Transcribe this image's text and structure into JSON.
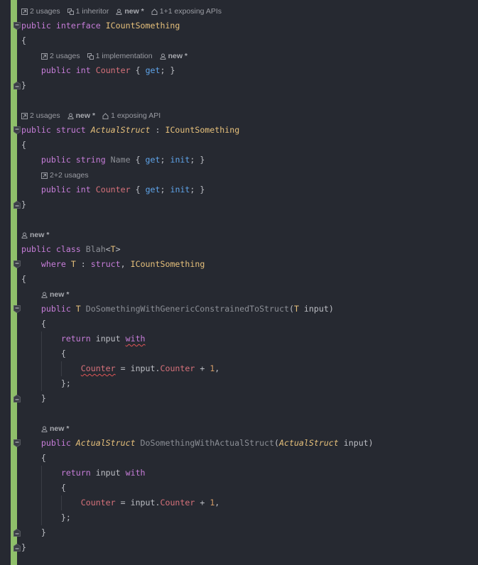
{
  "hints": {
    "interface": [
      {
        "icon": "usages-icon",
        "text": "2 usages"
      },
      {
        "icon": "inheritor-icon",
        "text": "1 inheritor"
      },
      {
        "icon": "author-icon",
        "text": "new *",
        "bold": true
      },
      {
        "icon": "api-icon",
        "text": "1+1 exposing APIs"
      }
    ],
    "interface_counter": [
      {
        "icon": "usages-icon",
        "text": "2 usages"
      },
      {
        "icon": "implementation-icon",
        "text": "1 implementation"
      },
      {
        "icon": "author-icon",
        "text": "new *",
        "bold": true
      }
    ],
    "struct": [
      {
        "icon": "usages-icon",
        "text": "2 usages"
      },
      {
        "icon": "author-icon",
        "text": "new *",
        "bold": true
      },
      {
        "icon": "api-icon",
        "text": "1 exposing API"
      }
    ],
    "struct_counter": [
      {
        "icon": "usages-icon",
        "text": "2+2 usages"
      }
    ],
    "class": [
      {
        "icon": "author-icon",
        "text": "new *",
        "bold": true
      }
    ],
    "method1": [
      {
        "icon": "author-icon",
        "text": "new *",
        "bold": true
      }
    ],
    "method2": [
      {
        "icon": "author-icon",
        "text": "new *",
        "bold": true
      }
    ]
  },
  "code": {
    "kw_public": "public",
    "kw_interface": "interface",
    "kw_struct": "struct",
    "kw_class": "class",
    "kw_int": "int",
    "kw_string": "string",
    "kw_where": "where",
    "kw_return": "return",
    "kw_with": "with",
    "kw_get": "get",
    "kw_init": "init",
    "iface_name": "ICountSomething",
    "struct_name": "ActualStruct",
    "class_name": "Blah",
    "type_param": "T",
    "prop_counter": "Counter",
    "prop_name": "Name",
    "method1_name": "DoSomethingWithGenericConstrainedToStruct",
    "method2_name": "DoSomethingWithActualStruct",
    "param_input": "input",
    "num_one": "1",
    "brace_open": "{",
    "brace_close": "}",
    "brace_close_semi": "};"
  },
  "colors": {
    "background": "#262931",
    "vcs_gutter": "#8fbf6a",
    "keyword": "#c77dd9",
    "type": "#e6c07b",
    "property": "#d6717a",
    "accessor": "#5fa4ea",
    "number": "#d19a66"
  }
}
